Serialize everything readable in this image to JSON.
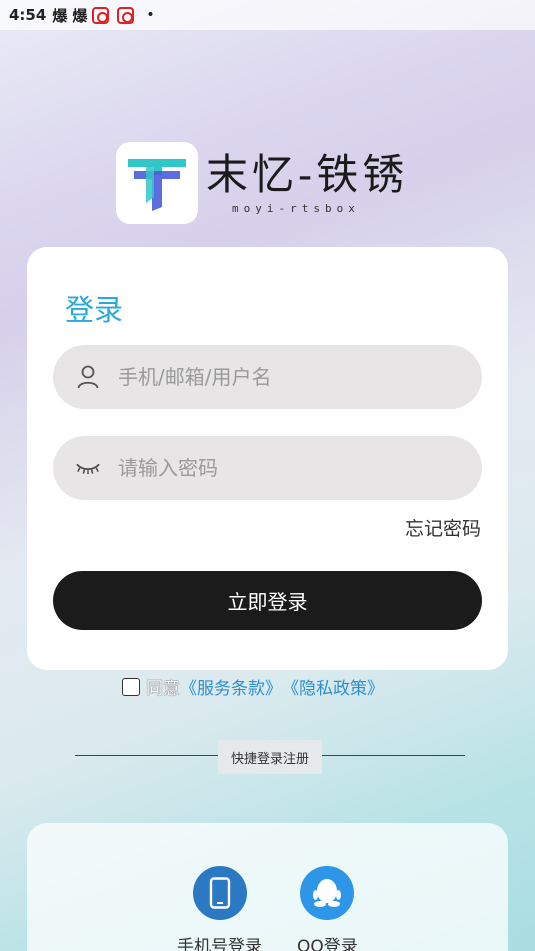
{
  "status_bar": {
    "time": "4:54",
    "glyph1": "爆",
    "glyph2": "爆",
    "dot": "•",
    "notification_icon_color": "#d22222"
  },
  "logo": {
    "title": "末忆-铁锈",
    "subtitle": "moyi-rtsbox",
    "icon": "t-logo-icon",
    "colors": {
      "teal": "#32c7c7",
      "blue": "#4a5ddc"
    }
  },
  "login": {
    "title": "登录",
    "username_placeholder": "手机/邮箱/用户名",
    "password_placeholder": "请输入密码",
    "forgot_password": "忘记密码",
    "submit": "立即登录",
    "accent_color": "#28a8df"
  },
  "agreement": {
    "prefix": "同意",
    "terms_link": "《服务条款》",
    "privacy_link": "《隐私政策》",
    "checked": false
  },
  "quick_login": {
    "divider_label": "快捷登录注册",
    "phone_label": "手机号登录",
    "qq_label": "QQ登录"
  }
}
